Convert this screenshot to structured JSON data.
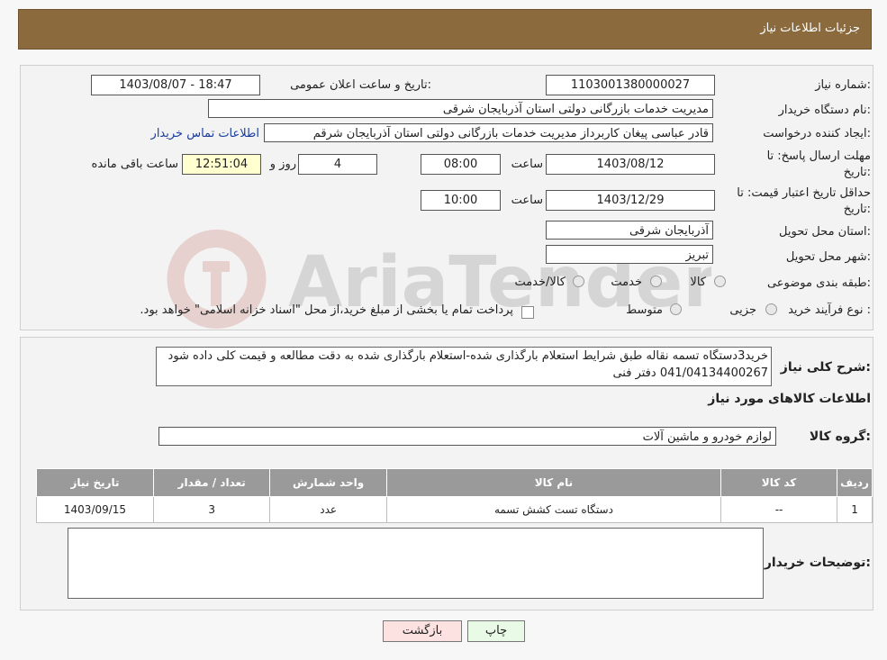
{
  "header": {
    "title": "جزئیات اطلاعات نیاز"
  },
  "form": {
    "need_number_label": "شماره نیاز:",
    "need_number": "1103001380000027",
    "announce_label": "تاریخ و ساعت اعلان عمومی:",
    "announce_value": "1403/08/07 - 18:47",
    "buyer_org_label": "نام دستگاه خریدار:",
    "buyer_org": "مدیریت خدمات بازرگانی دولتی استان آذربایجان شرقی",
    "requester_label": "ایجاد کننده درخواست:",
    "requester": "قادر عباسی پیغان کاربرداز مدیریت خدمات بازرگانی دولتی استان آذربایجان شرقم",
    "contact_link": "اطلاعات تماس خریدار",
    "deadline_label_1": "مهلت ارسال پاسخ: تا",
    "deadline_label_2": "تاریخ:",
    "deadline_date": "1403/08/12",
    "time_label": "ساعت",
    "deadline_time": "08:00",
    "days_value": "4",
    "days_label": "روز و",
    "remaining_time": "12:51:04",
    "remaining_label": "ساعت باقی مانده",
    "validity_label_1": "حداقل تاریخ اعتبار قیمت: تا",
    "validity_label_2": "تاریخ:",
    "validity_date": "1403/12/29",
    "validity_time_label": "ساعت",
    "validity_time": "10:00",
    "province_label": "استان محل تحویل:",
    "province": "آذربایجان شرقی",
    "city_label": "شهر محل تحویل:",
    "city": "تبریز",
    "category_label": "طبقه بندی موضوعی:",
    "category_options": [
      "کالا",
      "خدمت",
      "کالا/خدمت"
    ],
    "process_label": "نوع فرآیند خرید :",
    "process_options": [
      "جزیی",
      "متوسط"
    ],
    "process_note": "پرداخت تمام یا بخشی از مبلغ خرید،از محل \"اسناد خزانه اسلامی\" خواهد بود."
  },
  "summary": {
    "label": "شرح کلی نیاز:",
    "text": "خرید3دستگاه تسمه نقاله طبق شرایط استعلام بارگذاری شده-استعلام بارگذاری شده به دقت مطالعه و قیمت کلی داده شود 041/04134400267 دفتر فنی",
    "goods_info_title": "اطلاعات کالاهای مورد نیاز",
    "goods_group_label": "گروه کالا:",
    "goods_group": "لوازم خودرو و ماشین آلات"
  },
  "table": {
    "headers": [
      "ردیف",
      "کد کالا",
      "نام کالا",
      "واحد شمارش",
      "تعداد / مقدار",
      "تاریخ نیاز"
    ],
    "rows": [
      [
        "1",
        "--",
        "دستگاه تست کشش تسمه",
        "عدد",
        "3",
        "1403/09/15"
      ]
    ]
  },
  "buyer_notes": {
    "label": "توضیحات خریدار:",
    "text": ""
  },
  "buttons": {
    "print": "چاپ",
    "back": "بازگشت"
  },
  "watermark": {
    "text": "AriaTender.neT"
  },
  "colors": {
    "header_bg": "#8b6a3d",
    "print_btn": "#e9fbe6",
    "back_btn": "#fde2e2",
    "link": "#1a3d9c"
  }
}
